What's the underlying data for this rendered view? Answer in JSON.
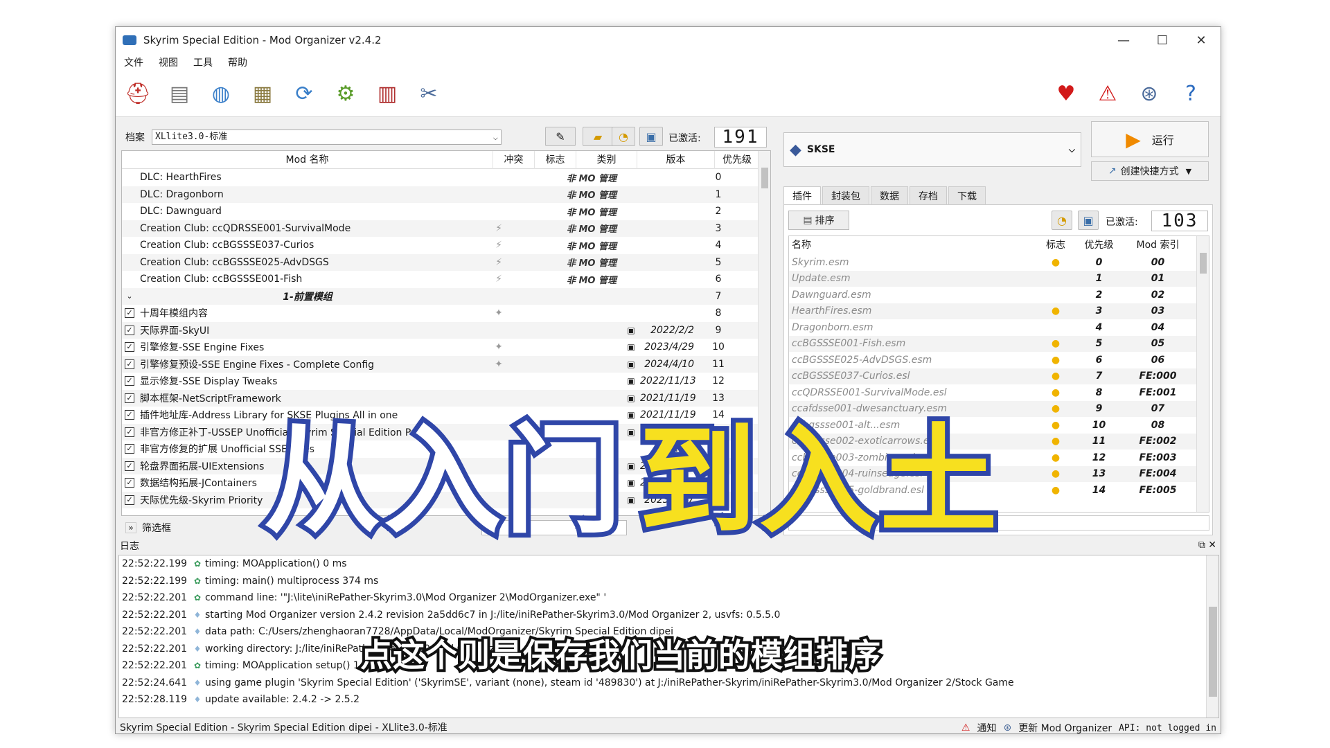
{
  "window": {
    "title": "Skyrim Special Edition - Mod Organizer v2.4.2",
    "minimize": "—",
    "maximize": "☐",
    "close": "✕"
  },
  "menu": [
    "文件",
    "视图",
    "工具",
    "帮助"
  ],
  "toolbar_icons": [
    "profile-icon",
    "instance-icon",
    "nexus-globe-icon",
    "ini-editor-icon",
    "refresh-icon",
    "settings-gear-icon",
    "tools-icon",
    "wrench-icon",
    "endorse-heart-icon",
    "problems-warning-icon",
    "update-globe-icon",
    "help-icon"
  ],
  "profile": {
    "label": "档案",
    "value": "XLlite3.0-标准",
    "active_label": "已激活:",
    "active_count": "191"
  },
  "modlist": {
    "headers": [
      "Mod 名称",
      "冲突",
      "标志",
      "类别",
      "版本",
      "优先级"
    ],
    "rows": [
      {
        "name": "DLC: HearthFires",
        "category": "非 MO 管理",
        "priority": "0"
      },
      {
        "name": "DLC: Dragonborn",
        "category": "非 MO 管理",
        "priority": "1"
      },
      {
        "name": "DLC: Dawnguard",
        "category": "非 MO 管理",
        "priority": "2"
      },
      {
        "name": "Creation Club: ccQDRSSE001-SurvivalMode",
        "conflict": "⚡",
        "category": "非 MO 管理",
        "priority": "3"
      },
      {
        "name": "Creation Club: ccBGSSSE037-Curios",
        "conflict": "⚡",
        "category": "非 MO 管理",
        "priority": "4"
      },
      {
        "name": "Creation Club: ccBGSSSE025-AdvDSGS",
        "conflict": "⚡",
        "category": "非 MO 管理",
        "priority": "5"
      },
      {
        "name": "Creation Club: ccBGSSSE001-Fish",
        "conflict": "⚡",
        "category": "非 MO 管理",
        "priority": "6"
      },
      {
        "name": "1-前置模组",
        "separator": true,
        "priority": "7"
      },
      {
        "name": "十周年模组内容",
        "checked": true,
        "conflict": "✦",
        "priority": "8"
      },
      {
        "name": "天际界面-SkyUI",
        "checked": true,
        "vicon": "▣",
        "version": "2022/2/2",
        "priority": "9"
      },
      {
        "name": "引擎修复-SSE Engine Fixes",
        "checked": true,
        "conflict": "✦",
        "vicon": "▣",
        "version": "2023/4/29",
        "priority": "10"
      },
      {
        "name": "引擎修复预设-SSE Engine Fixes - Complete Config",
        "checked": true,
        "conflict": "✦",
        "vicon": "▣",
        "version": "2024/4/10",
        "priority": "11"
      },
      {
        "name": "显示修复-SSE Display Tweaks",
        "checked": true,
        "vicon": "▣",
        "version": "2022/11/13",
        "priority": "12"
      },
      {
        "name": "脚本框架-NetScriptFramework",
        "checked": true,
        "vicon": "▣",
        "version": "2021/11/19",
        "priority": "13"
      },
      {
        "name": "插件地址库-Address Library for SKSE Plugins All in one",
        "checked": true,
        "vicon": "▣",
        "version": "2021/11/19",
        "priority": "14"
      },
      {
        "name": "非官方修正补丁-USSEP Unofficial Skyrim Special Edition Patch",
        "checked": true,
        "vicon": "▣",
        "version": "2021/8/20",
        "priority": "15"
      },
      {
        "name": "非官方修复的扩展 Unofficial SSE Fixes",
        "checked": true,
        "version": "1.2.2",
        "priority": "16"
      },
      {
        "name": "轮盘界面拓展-UIExtensions",
        "checked": true,
        "vicon": "▣",
        "version": "2021/11/19",
        "priority": "17"
      },
      {
        "name": "数据结构拓展-JContainers",
        "checked": true,
        "vicon": "▣",
        "version": "2021/11/19",
        "priority": "18"
      },
      {
        "name": "天际优先级-Skyrim Priority",
        "checked": true,
        "vicon": "▣",
        "version": "2023/8/17",
        "priority": "19"
      }
    ],
    "filter_label": "筛选框",
    "filter_expand": "»"
  },
  "executable": {
    "name": "SKSE",
    "run_label": "运行",
    "shortcut_label": "创建快捷方式"
  },
  "tabs": [
    "插件",
    "封装包",
    "数据",
    "存档",
    "下载"
  ],
  "plugins": {
    "sort_label": "排序",
    "active_label": "已激活:",
    "active_count": "103",
    "headers": [
      "名称",
      "标志",
      "优先级",
      "Mod 索引"
    ],
    "rows": [
      {
        "name": "Skyrim.esm",
        "flag": "●",
        "priority": "0",
        "index": "00"
      },
      {
        "name": "Update.esm",
        "flag": "",
        "priority": "1",
        "index": "01"
      },
      {
        "name": "Dawnguard.esm",
        "flag": "",
        "priority": "2",
        "index": "02"
      },
      {
        "name": "HearthFires.esm",
        "flag": "●",
        "priority": "3",
        "index": "03"
      },
      {
        "name": "Dragonborn.esm",
        "flag": "",
        "priority": "4",
        "index": "04"
      },
      {
        "name": "ccBGSSSE001-Fish.esm",
        "flag": "●",
        "priority": "5",
        "index": "05"
      },
      {
        "name": "ccBGSSSE025-AdvDSGS.esm",
        "flag": "●",
        "priority": "6",
        "index": "06"
      },
      {
        "name": "ccBGSSSE037-Curios.esl",
        "flag": "●",
        "priority": "7",
        "index": "FE:000"
      },
      {
        "name": "ccQDRSSE001-SurvivalMode.esl",
        "flag": "●",
        "priority": "8",
        "index": "FE:001"
      },
      {
        "name": "ccafdsse001-dwesanctuary.esm",
        "flag": "●",
        "priority": "9",
        "index": "07"
      },
      {
        "name": "ccbgssse001-alt...esm",
        "flag": "●",
        "priority": "10",
        "index": "08"
      },
      {
        "name": "ccbgssse002-exoticarrows.esl",
        "flag": "●",
        "priority": "11",
        "index": "FE:002"
      },
      {
        "name": "ccbgssse003-zombies.esl",
        "flag": "●",
        "priority": "12",
        "index": "FE:003"
      },
      {
        "name": "ccbgssse004-ruinsedge.esl",
        "flag": "●",
        "priority": "13",
        "index": "FE:004"
      },
      {
        "name": "ccbgssse005-goldbrand.esl",
        "flag": "●",
        "priority": "14",
        "index": "FE:005"
      }
    ]
  },
  "log": {
    "title": "日志",
    "rows": [
      {
        "ts": "22:52:22.199",
        "type": "timing",
        "msg": "timing: MOApplication() 0 ms"
      },
      {
        "ts": "22:52:22.199",
        "type": "timing",
        "msg": "timing: main() multiprocess 374 ms"
      },
      {
        "ts": "22:52:22.201",
        "type": "timing",
        "msg": "command line: '\"J:\\lite\\iniRePather-Skyrim3.0\\Mod Organizer 2\\ModOrganizer.exe\" '"
      },
      {
        "ts": "22:52:22.201",
        "type": "info",
        "msg": "starting Mod Organizer version 2.4.2 revision 2a5dd6c7 in J:/lite/iniRePather-Skyrim3.0/Mod Organizer 2, usvfs: 0.5.5.0"
      },
      {
        "ts": "22:52:22.201",
        "type": "info",
        "msg": "data path: C:/Users/zhenghaoran7728/AppData/Local/ModOrganizer/Skyrim Special Edition dipei"
      },
      {
        "ts": "22:52:22.201",
        "type": "info",
        "msg": "working directory: J:/lite/iniRePather-Skyrim3.0/Mod Organizer 2"
      },
      {
        "ts": "22:52:22.201",
        "type": "timing",
        "msg": "timing: MOApplication setup() 1"
      },
      {
        "ts": "22:52:24.641",
        "type": "info",
        "msg": "using game plugin 'Skyrim Special Edition' ('SkyrimSE', variant (none), steam id '489830') at J:/iniRePather-Skyrim/iniRePather-Skyrim3.0/Mod Organizer 2/Stock Game"
      },
      {
        "ts": "22:52:28.119",
        "type": "info",
        "msg": "update available: 2.4.2 -> 2.5.2"
      }
    ]
  },
  "status": {
    "left": "Skyrim Special Edition - Skyrim Special Edition dipei - XLlite3.0-标准",
    "notify": "通知",
    "update": "更新 Mod Organizer",
    "api": "API: not logged in"
  },
  "overlay": {
    "title_part1": "从入门",
    "title_part2": "到入土",
    "subtitle": "点这个则是保存我们当前的模组排序",
    "accent_yellow": "#f7e01f",
    "outline_blue": "#2f46a8"
  }
}
